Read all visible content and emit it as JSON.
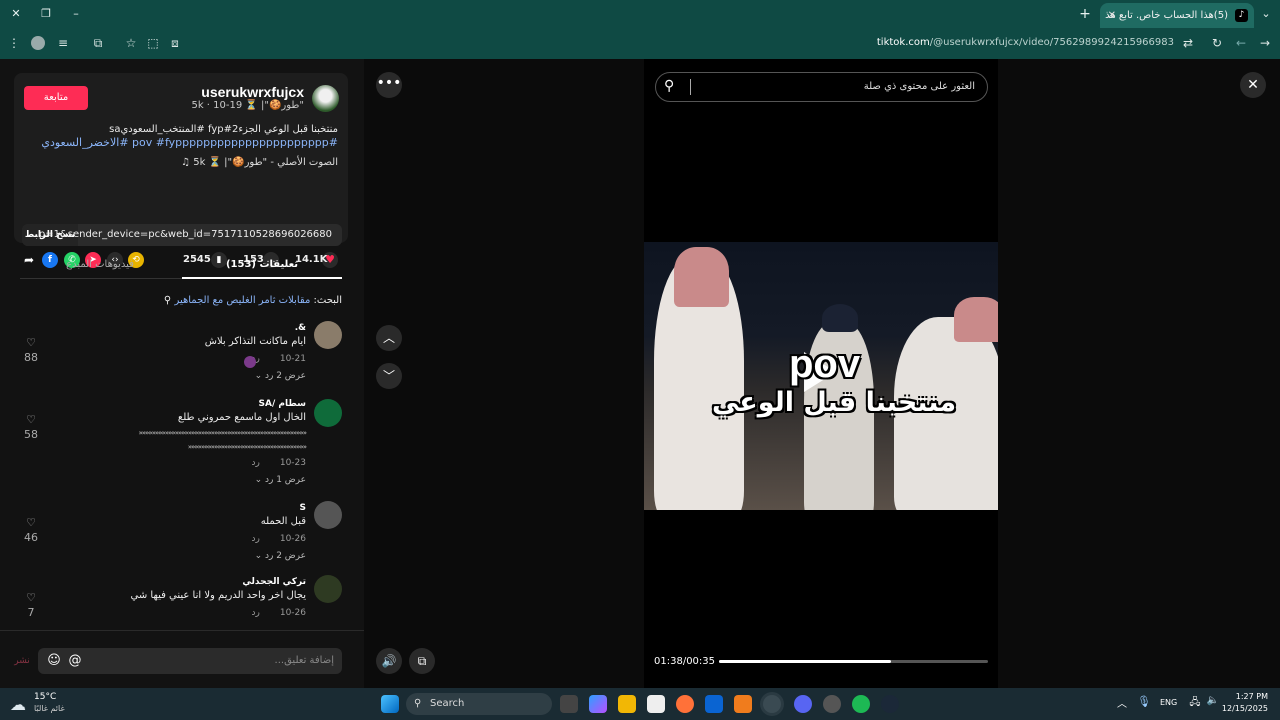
{
  "browser": {
    "tab_title": "(5)هذا الحساب خاص. تابع هذ",
    "tab_logo": "♪",
    "url_host": "tiktok.com",
    "url_path": "/@userukwrxfujcx/video/7562989924215966983"
  },
  "video_owner": {
    "username": "userukwrxfujcx",
    "subline": "\"طور🍪\"| ⏳ 5k · 10-19",
    "follow_label": "متابعة",
    "description_line1": "منتخبنا قبل الوعي الجزء2#fyp #المنتخب_السعوديsa",
    "description_line2": "#pov #fypppppppppppppppppppppp #الاخضر_السعودي",
    "sound": "الصوت الأصلي - \"طور🍪\"| ⏳ 5k"
  },
  "stats": {
    "likes": "14.1K",
    "comments": "153",
    "saves": "2545"
  },
  "share": {
    "copy_label": "نسخ الرابط",
    "link": "...p=1&sender_device=pc&web_id=7517110528696026680"
  },
  "tabs": {
    "comments_label": "تعليقات (153)",
    "creator_videos_label": "فيديوهات المبدع"
  },
  "search_suggestion": {
    "prefix": "البحث:",
    "query": "مقابلات ثامر الغليص مع الجماهير"
  },
  "comments": [
    {
      "user": "&.",
      "text": "ايام ماكانت التذاكر بلاش",
      "date": "10-21",
      "reply": "رد",
      "replies": "عرض 2 رد",
      "likes": "88"
    },
    {
      "user": "سطام /SA",
      "text": "الخال اول ماسمع حمروني طلع",
      "text2": "«««««««««««««««««««««««««««««««««««««««««««««««««««",
      "text3": "««««««««««««««««««««««««««««««««««««",
      "date": "10-23",
      "reply": "رد",
      "replies": "عرض 1 رد",
      "likes": "58"
    },
    {
      "user": "S",
      "text": "قبل الحمله",
      "date": "10-26",
      "reply": "رد",
      "replies": "عرض 2 رد",
      "likes": "46"
    },
    {
      "user": "تركي الجحدلي",
      "text": "يجال اخر واحد الدريم ولا انا عيني فيها شي",
      "date": "10-26",
      "reply": "رد",
      "replies": "",
      "likes": "7"
    }
  ],
  "comment_input": {
    "placeholder": "إضافة تعليق...",
    "mention_icon": "@",
    "emoji_icon": "☺",
    "send_label": "نشر"
  },
  "player": {
    "search_placeholder": "العثور على محتوى ذي صلة",
    "overlay_text_top": "pov",
    "overlay_text_bottom": "منتخبنا قبل الوعي",
    "time": "01:38/00:35",
    "progress_fraction": 0.64
  },
  "taskbar": {
    "temperature": "15°C",
    "weather_desc": "غائم غالبًا",
    "search_label": "Search",
    "language": "ENG",
    "time": "1:27 PM",
    "date": "12/15/2025"
  },
  "colors": {
    "accent": "#fe2c55",
    "chrome": "#0f4a44",
    "link": "#8ab4f8"
  }
}
